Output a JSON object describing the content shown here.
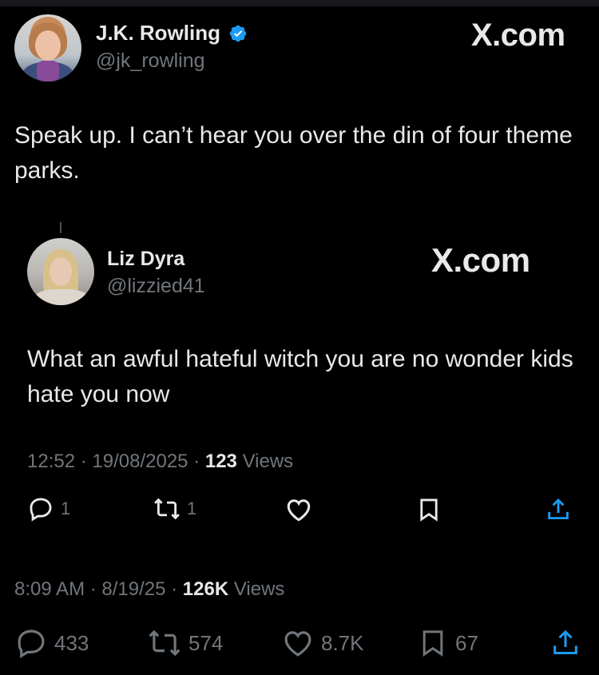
{
  "tweet": {
    "author": {
      "name": "J.K. Rowling",
      "handle": "@jk_rowling",
      "verified": true
    },
    "brand": "X.com",
    "text": "Speak up. I can’t hear you over the din of four theme parks.",
    "time": "8:09 AM",
    "date": "8/19/25",
    "views_count": "126K",
    "views_label": "Views",
    "actions": {
      "replies": "433",
      "reposts": "574",
      "likes": "8.7K",
      "bookmarks": "67"
    }
  },
  "quoted": {
    "author": {
      "name": "Liz Dyra",
      "handle": "@lizzied41"
    },
    "brand": "X.com",
    "text": "What an awful hateful witch you are no wonder kids hate you now",
    "time": "12:52",
    "date": "19/08/2025",
    "views_count": "123",
    "views_label": "Views",
    "actions": {
      "replies": "1",
      "reposts": "1"
    }
  },
  "icons": [
    "verified-badge-icon",
    "reply-icon",
    "repost-icon",
    "like-icon",
    "bookmark-icon",
    "share-icon"
  ],
  "colors": {
    "background": "#000000",
    "text": "#e7e9ea",
    "secondary": "#71767b",
    "verified": "#1d9bf0"
  }
}
